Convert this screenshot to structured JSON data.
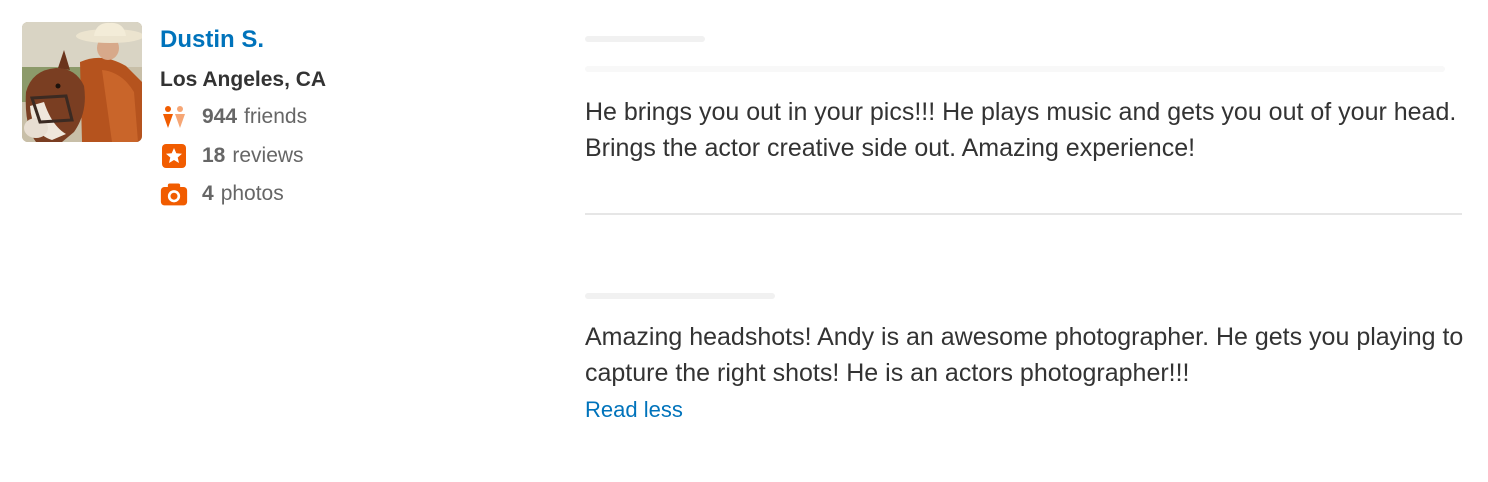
{
  "user": {
    "name": "Dustin S.",
    "location": "Los Angeles, CA",
    "stats": {
      "friends": {
        "count": "944",
        "label": "friends",
        "icon": "friends-icon"
      },
      "reviews": {
        "count": "18",
        "label": "reviews",
        "icon": "star-icon"
      },
      "photos": {
        "count": "4",
        "label": "photos",
        "icon": "camera-icon"
      }
    }
  },
  "reviews": [
    {
      "text": "He brings you out in your pics!!! He plays music and gets you out of your head. Brings the actor creative side out. Amazing experience!"
    },
    {
      "text": "Amazing headshots! Andy is an awesome photographer. He gets you playing to capture the right shots! He is an actors photographer!!!",
      "toggle_label": "Read less"
    }
  ],
  "colors": {
    "link_blue": "#0073bb",
    "text_dark": "#333333",
    "text_muted": "#666666",
    "accent_orange": "#f15c00",
    "divider": "#e6e6e6"
  }
}
